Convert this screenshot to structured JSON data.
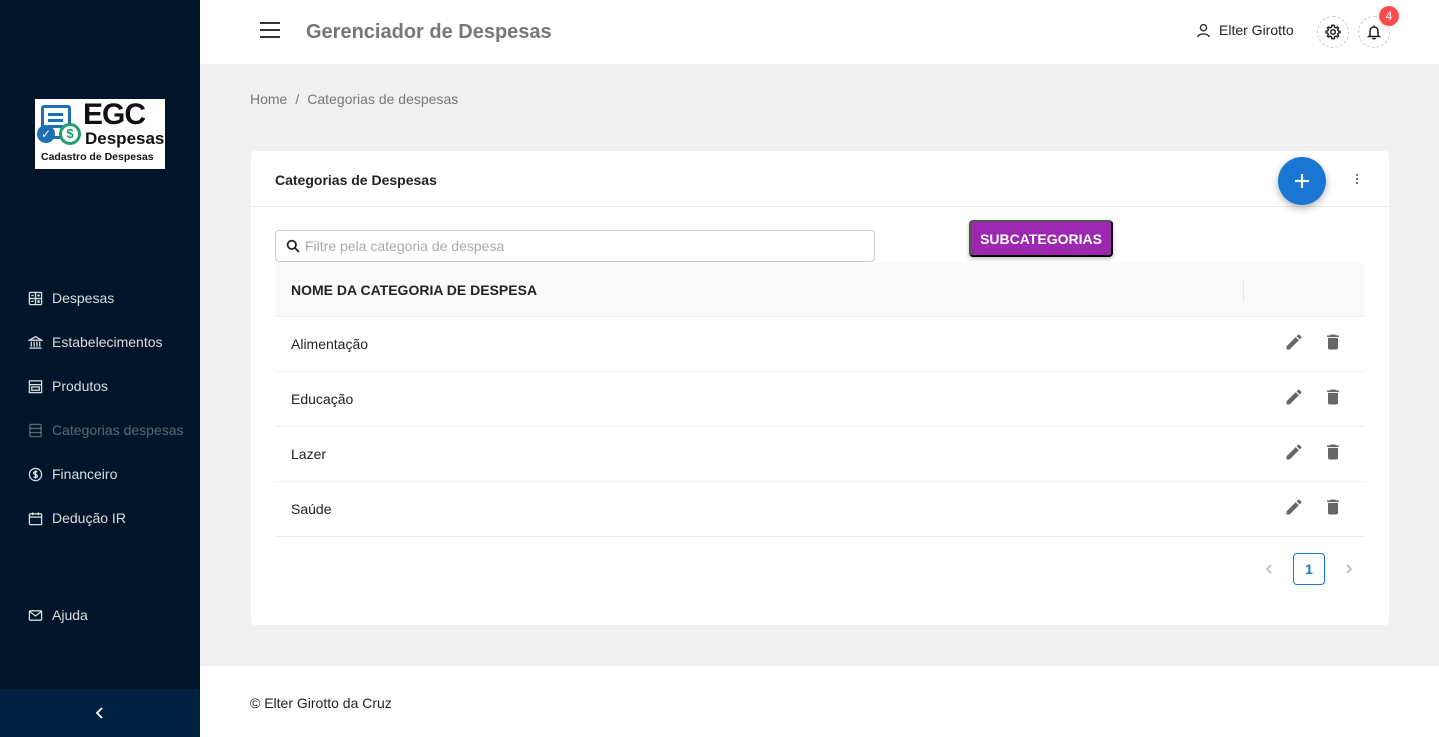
{
  "logo": {
    "title_line1": "EGC",
    "title_line2": "Despesas",
    "subtitle": "Cadastro de Despesas"
  },
  "sidebar": {
    "items": [
      {
        "label": "Despesas",
        "icon": "calculator-icon"
      },
      {
        "label": "Estabelecimentos",
        "icon": "bank-icon"
      },
      {
        "label": "Produtos",
        "icon": "shop-icon"
      },
      {
        "label": "Categorias despesas",
        "icon": "database-icon",
        "active": true
      },
      {
        "label": "Financeiro",
        "icon": "dollar-icon"
      },
      {
        "label": "Dedução IR",
        "icon": "calendar-icon"
      }
    ],
    "help": {
      "label": "Ajuda",
      "icon": "mail-icon"
    }
  },
  "header": {
    "title": "Gerenciador de Despesas",
    "user_name": "Elter Girotto",
    "notification_count": "4"
  },
  "breadcrumb": {
    "home": "Home",
    "separator": "/",
    "current": "Categorias de despesas"
  },
  "card": {
    "title": "Categorias de Despesas",
    "search_placeholder": "Filtre pela categoria de despesa",
    "search_value": "",
    "subcategories_button": "SUBCATEGORIAS",
    "table": {
      "column_header": "NOME DA CATEGORIA DE DESPESA",
      "rows": [
        "Alimentação",
        "Educação",
        "Lazer",
        "Saúde"
      ]
    },
    "pagination": {
      "current_page": "1"
    }
  },
  "footer": {
    "text": "© Elter Girotto da Cruz"
  },
  "colors": {
    "sidebar_bg": "#001529",
    "primary": "#1976d2",
    "subcategory_button": "#9c27b0",
    "badge": "#ff4d4f"
  }
}
